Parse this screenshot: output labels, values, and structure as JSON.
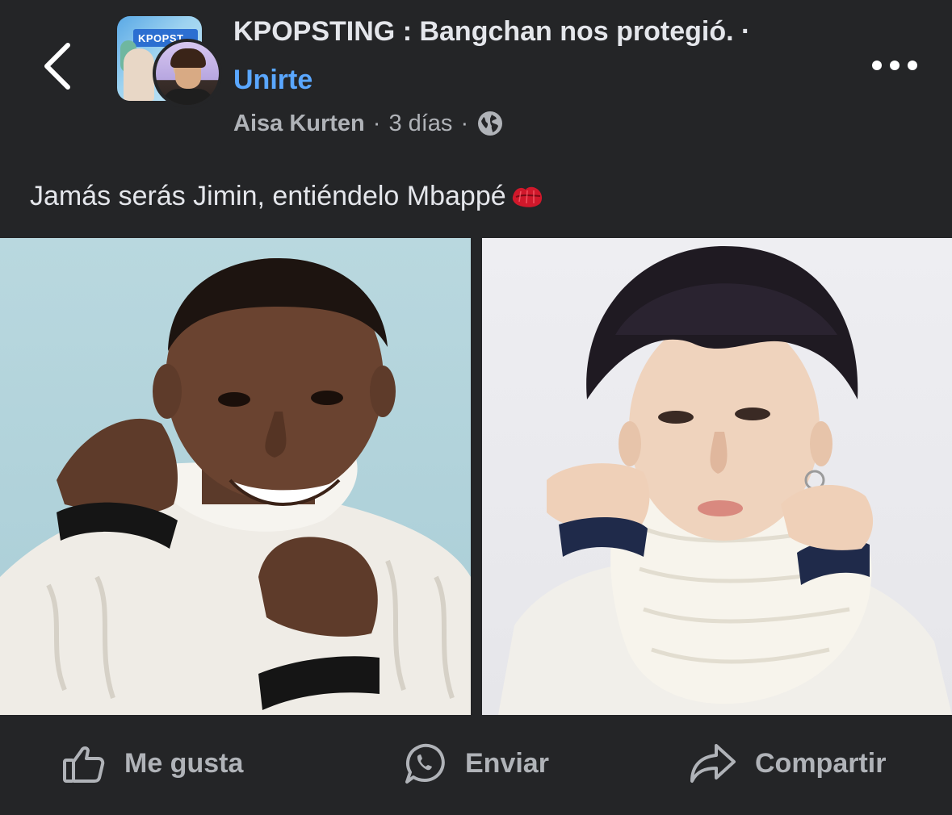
{
  "header": {
    "group_title": "KPOPSTING : Bangchan nos protegió. ·",
    "join_label": "Unirte",
    "group_avatar_text": "KPOPST",
    "author": "Aisa Kurten",
    "time": "3 días"
  },
  "post": {
    "text": "Jamás serás Jimin, entiéndelo Mbappé",
    "emoji": "kiss-mark-icon"
  },
  "actions": {
    "like_label": "Me gusta",
    "send_label": "Enviar",
    "share_label": "Compartir"
  },
  "colors": {
    "background": "#242527",
    "text": "#e4e6eb",
    "secondary_text": "#b0b3b8",
    "link": "#5aa7ff"
  }
}
